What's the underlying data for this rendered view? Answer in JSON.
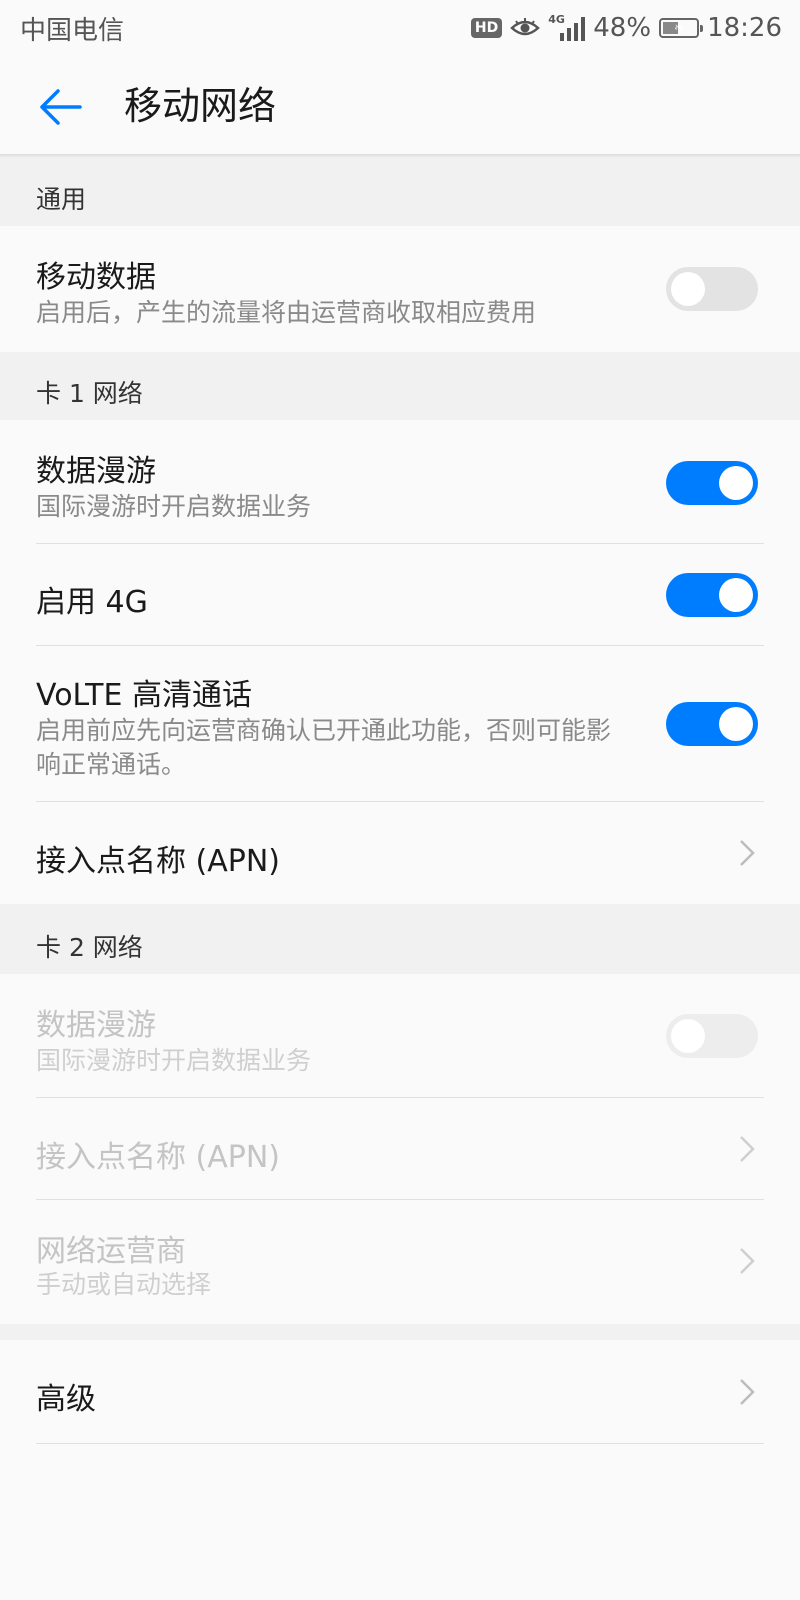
{
  "status_bar": {
    "carrier": "中国电信",
    "hd_label": "HD",
    "network_type": "4G",
    "battery_percent": "48%",
    "battery_level": 0.48,
    "time": "18:26"
  },
  "app_bar": {
    "title": "移动网络",
    "back_icon": "arrow-left-icon"
  },
  "accent_color": "#007dff",
  "sections": {
    "general": {
      "header": "通用",
      "mobile_data": {
        "title": "移动数据",
        "subtitle": "启用后，产生的流量将由运营商收取相应费用",
        "enabled": false
      }
    },
    "sim1": {
      "header": "卡 1 网络",
      "data_roaming": {
        "title": "数据漫游",
        "subtitle": "国际漫游时开启数据业务",
        "enabled": true
      },
      "enable_4g": {
        "title": "启用 4G",
        "enabled": true
      },
      "volte": {
        "title": "VoLTE 高清通话",
        "subtitle": "启用前应先向运营商确认已开通此功能，否则可能影响正常通话。",
        "enabled": true
      },
      "apn": {
        "title": "接入点名称 (APN)"
      }
    },
    "sim2": {
      "header": "卡 2 网络",
      "data_roaming": {
        "title": "数据漫游",
        "subtitle": "国际漫游时开启数据业务",
        "enabled": false
      },
      "apn": {
        "title": "接入点名称 (APN)"
      },
      "operator": {
        "title": "网络运营商",
        "subtitle": "手动或自动选择"
      }
    },
    "advanced": {
      "title": "高级"
    }
  }
}
